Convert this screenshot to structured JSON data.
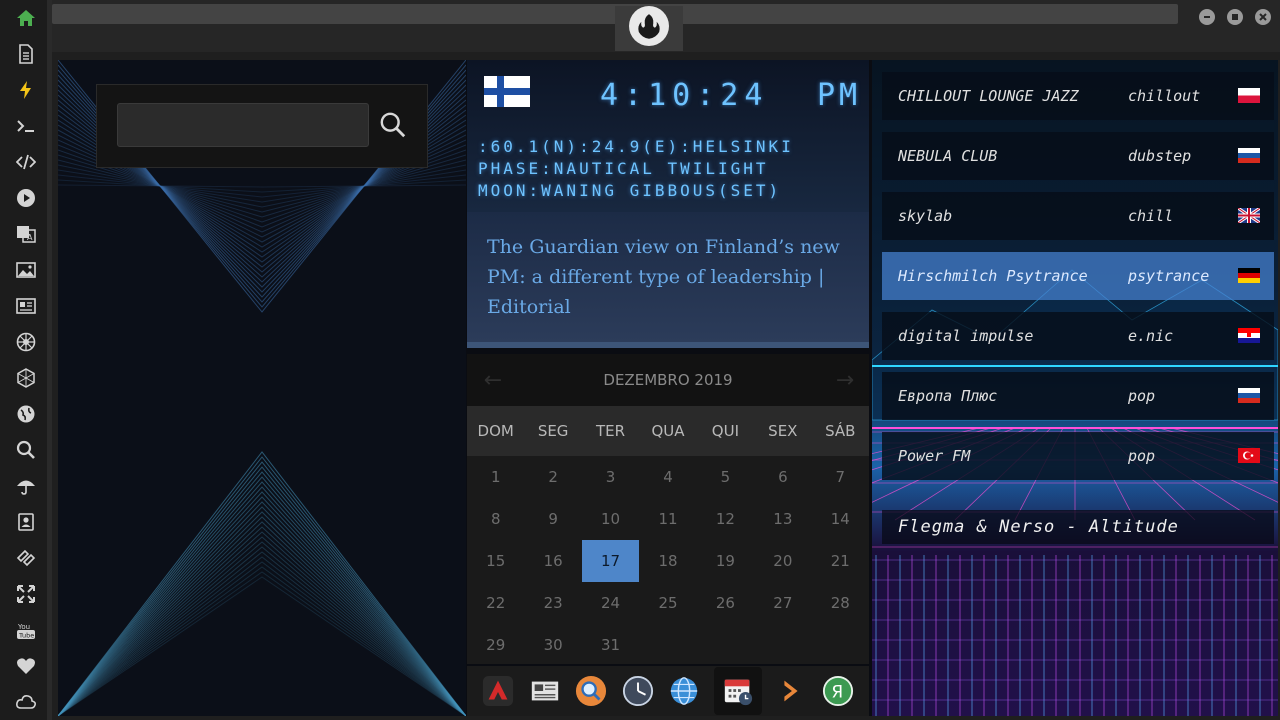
{
  "sidebar": {
    "items": [
      {
        "name": "home-icon",
        "color": "#4caf50"
      },
      {
        "name": "document-icon"
      },
      {
        "name": "lightning-icon",
        "color": "#f5c518"
      },
      {
        "name": "terminal-icon"
      },
      {
        "name": "code-icon"
      },
      {
        "name": "play-icon"
      },
      {
        "name": "translate-icon"
      },
      {
        "name": "image-icon"
      },
      {
        "name": "news-icon"
      },
      {
        "name": "imperial-icon"
      },
      {
        "name": "hexagon-icon"
      },
      {
        "name": "globe-icon"
      },
      {
        "name": "search-icon"
      },
      {
        "name": "umbrella-icon"
      },
      {
        "name": "contacts-icon"
      },
      {
        "name": "tags-icon"
      },
      {
        "name": "expand-icon"
      },
      {
        "name": "youtube-icon"
      },
      {
        "name": "heart-icon"
      },
      {
        "name": "cloud-icon"
      }
    ]
  },
  "search": {
    "value": "",
    "placeholder": ""
  },
  "clock": {
    "time": "4:10:24",
    "ampm": "PM",
    "location": ":60.1(N):24.9(E):HELSINKI",
    "phase": "PHASE:NAUTICAL TWILIGHT",
    "moon": "MOON:WANING GIBBOUS(SET)",
    "country_flag": "finland-flag"
  },
  "news": {
    "headline": "The Guardian view on Finland’s new PM: a different type of leadership | Editorial"
  },
  "calendar": {
    "month_label": "DEZEMBRO 2019",
    "prev_label": "←",
    "next_label": "→",
    "weekdays": [
      "DOM",
      "SEG",
      "TER",
      "QUA",
      "QUI",
      "SEX",
      "SÁB"
    ],
    "days": [
      "1",
      "2",
      "3",
      "4",
      "5",
      "6",
      "7",
      "8",
      "9",
      "10",
      "11",
      "12",
      "13",
      "14",
      "15",
      "16",
      "17",
      "18",
      "19",
      "20",
      "21",
      "22",
      "23",
      "24",
      "25",
      "26",
      "27",
      "28",
      "29",
      "30",
      "31"
    ],
    "today": "17",
    "accent": "#4e86c9"
  },
  "dock": {
    "items": [
      {
        "name": "red-arrow-app-icon"
      },
      {
        "name": "newspaper-app-icon"
      },
      {
        "name": "search-app-icon"
      },
      {
        "name": "clock-app-icon"
      },
      {
        "name": "globe-app-icon"
      },
      {
        "name": "calendar-app-icon",
        "active": true
      },
      {
        "name": "next-app-icon"
      },
      {
        "name": "yandex-app-icon"
      }
    ]
  },
  "radio": {
    "stations": [
      {
        "name": "CHILLOUT LOUNGE JAZZ",
        "genre": "chillout",
        "flag": "poland-flag"
      },
      {
        "name": "NEBULA CLUB",
        "genre": "dubstep",
        "flag": "russia-flag"
      },
      {
        "name": "skylab",
        "genre": "chill",
        "flag": "uk-flag"
      },
      {
        "name": "Hirschmilch Psytrance",
        "genre": "psytrance",
        "flag": "germany-flag",
        "selected": true
      },
      {
        "name": "digital impulse",
        "genre": "e.nic",
        "flag": "croatia-flag"
      },
      {
        "name": "Европа Плюс",
        "genre": "pop",
        "flag": "russia-flag"
      },
      {
        "name": "Power FM",
        "genre": "pop",
        "flag": "turkey-flag"
      }
    ],
    "now_playing": "Flegma & Nerso - Altitude"
  }
}
